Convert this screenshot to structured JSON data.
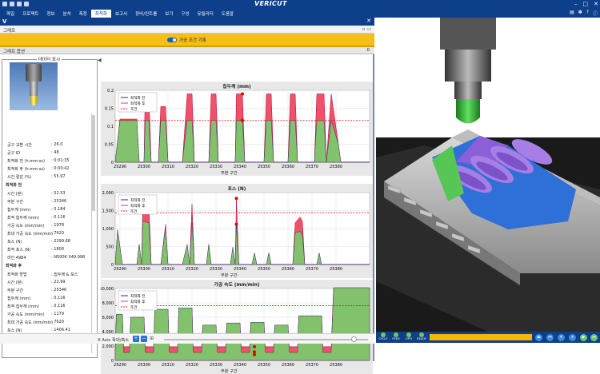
{
  "app": {
    "title": "VERICUT"
  },
  "menu": [
    "파일",
    "프로젝트",
    "정보",
    "분석",
    "측정",
    "최적화",
    "보고서",
    "장비/컨트롤",
    "보기",
    "구성",
    "유틸리티",
    "도움말"
  ],
  "menu_active": 5,
  "pane": {
    "title": "V",
    "tab": "그래프",
    "toggle_label": "가공 조건 기록",
    "options_label": "그래프 옵션",
    "options_count": "0"
  },
  "data_panel": {
    "title": "데이터 표시",
    "rows": [
      {
        "k": "공구 교환 시간",
        "v": ": 26.0",
        "sec": false
      },
      {
        "k": "공구 ID",
        "v": ": 48",
        "sec": false
      },
      {
        "k": "최적화 전 (h:mm:ss)",
        "v": ": 0:01:35",
        "sec": false
      },
      {
        "k": "최적화 후 (h:mm:ss)",
        "v": ": 0:00:42",
        "sec": false
      },
      {
        "k": "시간 절감 (%)",
        "v": ": 55.97",
        "sec": false
      },
      {
        "k": "최적화 전",
        "v": "",
        "sec": true
      },
      {
        "k": "시간 (분)",
        "v": ": 52.53",
        "sec": false
      },
      {
        "k": "부분 구간",
        "v": ": 25346",
        "sec": false
      },
      {
        "k": "칩두께 (mm)",
        "v": ": 0.184",
        "sec": false
      },
      {
        "k": "최적 칩두께 (mm)",
        "v": ": 0.116",
        "sec": false
      },
      {
        "k": "가공 속도 (mm/min)",
        "v": ": 1978",
        "sec": false
      },
      {
        "k": "최대 가공 속도 (mm/min)",
        "v": ": 7620",
        "sec": false
      },
      {
        "k": "포스 (N)",
        "v": ": 2299.68",
        "sec": false
      },
      {
        "k": "최적 포스 (N)",
        "v": ": 1800",
        "sec": false
      },
      {
        "k": "라인 4984",
        "v": ": N5006 X49.996",
        "sec": false
      },
      {
        "k": "최적화 후",
        "v": "",
        "sec": true
      },
      {
        "k": "최적화 방법",
        "v": ": 칩두께 & 포스",
        "sec": false
      },
      {
        "k": "시간 (분)",
        "v": ": 22.99",
        "sec": false
      },
      {
        "k": "부분 구간",
        "v": ": 25346",
        "sec": false
      },
      {
        "k": "칩두께 (mm)",
        "v": ": 0.116",
        "sec": false
      },
      {
        "k": "최적 칩두께 (mm)",
        "v": ": 0.116",
        "sec": false
      },
      {
        "k": "가공 속도 (mm/min)",
        "v": ": 1179",
        "sec": false
      },
      {
        "k": "최대 가공 속도 (mm/min)",
        "v": ": 7620",
        "sec": false
      },
      {
        "k": "포스 (N)",
        "v": ": 1406.41",
        "sec": false
      },
      {
        "k": "최적 포스 (N)",
        "v": ": 1800",
        "sec": false
      }
    ]
  },
  "bottom": {
    "x_axis_label": "X Axis 확대/축소"
  },
  "viewer": {
    "controls": [
      "CYCLE",
      "FEED",
      "OPTI",
      "READY"
    ]
  },
  "chart_data": [
    {
      "type": "area",
      "title": "칩두께 (mm)",
      "xlabel": "부분 구간",
      "ylim": [
        0,
        0.2
      ],
      "yticks": [
        "0",
        "0.05",
        "0.1",
        "0.15",
        "0.2"
      ],
      "xticks": [
        "25290",
        "25300",
        "25310",
        "25320",
        "25330",
        "25340",
        "25350",
        "25360",
        "25370",
        "25380"
      ],
      "xlim": [
        25288,
        25394
      ],
      "limit": 0.116,
      "legend": [
        "최적화 전",
        "최적화 후",
        "조건"
      ],
      "before": [
        [
          25288,
          0
        ],
        [
          25290,
          0.12
        ],
        [
          25297,
          0.12
        ],
        [
          25298,
          0
        ],
        [
          25300,
          0
        ],
        [
          25300.5,
          0.19
        ],
        [
          25302,
          0.19
        ],
        [
          25303,
          0
        ],
        [
          25306,
          0
        ],
        [
          25307,
          0.155
        ],
        [
          25309,
          0.155
        ],
        [
          25310,
          0
        ],
        [
          25316,
          0
        ],
        [
          25318,
          0.19
        ],
        [
          25320,
          0.19
        ],
        [
          25321,
          0
        ],
        [
          25327,
          0
        ],
        [
          25328,
          0.19
        ],
        [
          25330,
          0.19
        ],
        [
          25331,
          0
        ],
        [
          25338,
          0
        ],
        [
          25338.5,
          0.19
        ],
        [
          25341,
          0.19
        ],
        [
          25342,
          0
        ],
        [
          25350,
          0
        ],
        [
          25351,
          0.19
        ],
        [
          25353,
          0.19
        ],
        [
          25354,
          0
        ],
        [
          25360,
          0
        ],
        [
          25361,
          0.19
        ],
        [
          25363,
          0.19
        ],
        [
          25364,
          0
        ],
        [
          25371,
          0
        ],
        [
          25372,
          0.19
        ],
        [
          25375,
          0.19
        ],
        [
          25376,
          0
        ],
        [
          25378,
          0.19
        ],
        [
          25381,
          0.05
        ],
        [
          25382,
          0
        ],
        [
          25394,
          0
        ]
      ],
      "after": [
        [
          25288,
          0
        ],
        [
          25290,
          0.116
        ],
        [
          25297,
          0.116
        ],
        [
          25298,
          0
        ],
        [
          25300,
          0
        ],
        [
          25300.5,
          0.116
        ],
        [
          25302,
          0.116
        ],
        [
          25303,
          0
        ],
        [
          25306,
          0
        ],
        [
          25307,
          0.116
        ],
        [
          25309,
          0.116
        ],
        [
          25310,
          0
        ],
        [
          25316,
          0
        ],
        [
          25318,
          0.116
        ],
        [
          25320,
          0.116
        ],
        [
          25321,
          0
        ],
        [
          25327,
          0
        ],
        [
          25328,
          0.116
        ],
        [
          25330,
          0.116
        ],
        [
          25331,
          0
        ],
        [
          25338,
          0
        ],
        [
          25338.5,
          0.116
        ],
        [
          25341,
          0.116
        ],
        [
          25342,
          0
        ],
        [
          25350,
          0
        ],
        [
          25351,
          0.116
        ],
        [
          25353,
          0.116
        ],
        [
          25354,
          0
        ],
        [
          25360,
          0
        ],
        [
          25361,
          0.116
        ],
        [
          25363,
          0.116
        ],
        [
          25364,
          0
        ],
        [
          25371,
          0
        ],
        [
          25372,
          0.116
        ],
        [
          25375,
          0.116
        ],
        [
          25376,
          0
        ],
        [
          25378,
          0.116
        ],
        [
          25381,
          0.05
        ],
        [
          25382,
          0
        ],
        [
          25394,
          0
        ]
      ],
      "markers": [
        [
          25341,
          0.19
        ],
        [
          25341,
          0.116
        ]
      ]
    },
    {
      "type": "area",
      "title": "포스 (N)",
      "xlabel": "부분 구간",
      "ylim": [
        0,
        2500
      ],
      "yticks": [
        "0",
        "500",
        "1,000",
        "1,500",
        "2,000"
      ],
      "xticks": [
        "25290",
        "25300",
        "25310",
        "25320",
        "25330",
        "25340",
        "25350",
        "25360",
        "25370",
        "25380"
      ],
      "xlim": [
        25288,
        25394
      ],
      "limit": 1800,
      "legend": [
        "최적화 전",
        "최적화 후",
        "조건"
      ],
      "before": [
        [
          25288,
          0
        ],
        [
          25289,
          1200
        ],
        [
          25291,
          0
        ],
        [
          25297,
          0
        ],
        [
          25298,
          700
        ],
        [
          25299,
          0
        ],
        [
          25299.5,
          2150
        ],
        [
          25302,
          2150
        ],
        [
          25303,
          0
        ],
        [
          25307,
          0
        ],
        [
          25309,
          1400
        ],
        [
          25310,
          0
        ],
        [
          25316,
          0
        ],
        [
          25318,
          700
        ],
        [
          25319,
          0
        ],
        [
          25320,
          2100
        ],
        [
          25321,
          0
        ],
        [
          25326,
          0
        ],
        [
          25327,
          700
        ],
        [
          25328,
          0
        ],
        [
          25336,
          0
        ],
        [
          25337,
          600
        ],
        [
          25338,
          0
        ],
        [
          25338.5,
          2300
        ],
        [
          25339.5,
          0
        ],
        [
          25345,
          0
        ],
        [
          25346,
          400
        ],
        [
          25347,
          0
        ],
        [
          25351,
          0
        ],
        [
          25352,
          400
        ],
        [
          25353,
          0
        ],
        [
          25362,
          0
        ],
        [
          25363,
          1450
        ],
        [
          25365,
          1650
        ],
        [
          25366,
          1500
        ],
        [
          25367,
          0
        ],
        [
          25372,
          0
        ],
        [
          25373,
          400
        ],
        [
          25374,
          0
        ],
        [
          25380,
          0
        ],
        [
          25394,
          0
        ]
      ],
      "after": [
        [
          25288,
          0
        ],
        [
          25289,
          1200
        ],
        [
          25291,
          0
        ],
        [
          25297,
          0
        ],
        [
          25298,
          700
        ],
        [
          25299,
          0
        ],
        [
          25299.5,
          1500
        ],
        [
          25302,
          1450
        ],
        [
          25303,
          0
        ],
        [
          25307,
          0
        ],
        [
          25309,
          1300
        ],
        [
          25310,
          0
        ],
        [
          25316,
          0
        ],
        [
          25318,
          700
        ],
        [
          25319,
          0
        ],
        [
          25320,
          1450
        ],
        [
          25321,
          0
        ],
        [
          25326,
          0
        ],
        [
          25327,
          700
        ],
        [
          25328,
          0
        ],
        [
          25336,
          0
        ],
        [
          25337,
          600
        ],
        [
          25338,
          0
        ],
        [
          25338.5,
          1400
        ],
        [
          25339.5,
          0
        ],
        [
          25345,
          0
        ],
        [
          25346,
          400
        ],
        [
          25347,
          0
        ],
        [
          25351,
          0
        ],
        [
          25352,
          400
        ],
        [
          25353,
          0
        ],
        [
          25362,
          0
        ],
        [
          25363,
          1100
        ],
        [
          25365,
          1150
        ],
        [
          25366,
          1000
        ],
        [
          25367,
          0
        ],
        [
          25372,
          0
        ],
        [
          25373,
          400
        ],
        [
          25374,
          0
        ],
        [
          25380,
          0
        ],
        [
          25394,
          0
        ]
      ],
      "markers": [
        [
          25338.5,
          2300
        ],
        [
          25338.5,
          1400
        ]
      ]
    },
    {
      "type": "area",
      "title": "가공 속도 (mm/min)",
      "xlabel": "부분 구간",
      "ylim": [
        0,
        10000
      ],
      "yticks": [
        "0",
        "2,000",
        "4,000",
        "6,000",
        "8,000",
        "10,000"
      ],
      "xticks": [
        "25290",
        "25300",
        "25310",
        "25320",
        "25330",
        "25340",
        "25350",
        "25360",
        "25370",
        "25380"
      ],
      "xlim": [
        25288,
        25394
      ],
      "limit": 7620,
      "legend": [
        "최적화 전",
        "최적화 후",
        "조건"
      ],
      "before": [
        [
          25288,
          1900
        ],
        [
          25288.5,
          6400
        ],
        [
          25291,
          6400
        ],
        [
          25291.5,
          1900
        ],
        [
          25294,
          1900
        ],
        [
          25294.5,
          6000
        ],
        [
          25300,
          6000
        ],
        [
          25300.5,
          1900
        ],
        [
          25304,
          1900
        ],
        [
          25304.5,
          7100
        ],
        [
          25310,
          7100
        ],
        [
          25310.5,
          1900
        ],
        [
          25314,
          1900
        ],
        [
          25314.5,
          7300
        ],
        [
          25320,
          7300
        ],
        [
          25320.5,
          1900
        ],
        [
          25324,
          1900
        ],
        [
          25324.5,
          4900
        ],
        [
          25330,
          4900
        ],
        [
          25330.5,
          1900
        ],
        [
          25334,
          1900
        ],
        [
          25334.5,
          5200
        ],
        [
          25340,
          5200
        ],
        [
          25340.5,
          1900
        ],
        [
          25344,
          1900
        ],
        [
          25344.5,
          5300
        ],
        [
          25350,
          5300
        ],
        [
          25350.5,
          1900
        ],
        [
          25354,
          1900
        ],
        [
          25354.5,
          4900
        ],
        [
          25360,
          4900
        ],
        [
          25360.5,
          1900
        ],
        [
          25364,
          1900
        ],
        [
          25364.5,
          6200
        ],
        [
          25374,
          6200
        ],
        [
          25374.5,
          1900
        ],
        [
          25378,
          1900
        ],
        [
          25379,
          10100
        ],
        [
          25394,
          10100
        ]
      ],
      "after": [
        [
          25288,
          1100
        ],
        [
          25288.5,
          6400
        ],
        [
          25291,
          6400
        ],
        [
          25291.5,
          1100
        ],
        [
          25294,
          1100
        ],
        [
          25294.5,
          6000
        ],
        [
          25300,
          6000
        ],
        [
          25300.5,
          1100
        ],
        [
          25304,
          1100
        ],
        [
          25304.5,
          7100
        ],
        [
          25310,
          7100
        ],
        [
          25310.5,
          1100
        ],
        [
          25314,
          1100
        ],
        [
          25314.5,
          7300
        ],
        [
          25320,
          7300
        ],
        [
          25320.5,
          1100
        ],
        [
          25324,
          1100
        ],
        [
          25324.5,
          4900
        ],
        [
          25330,
          4900
        ],
        [
          25330.5,
          1100
        ],
        [
          25334,
          1100
        ],
        [
          25334.5,
          5200
        ],
        [
          25340,
          5200
        ],
        [
          25340.5,
          1100
        ],
        [
          25344,
          1100
        ],
        [
          25344.5,
          5300
        ],
        [
          25350,
          5300
        ],
        [
          25350.5,
          1100
        ],
        [
          25354,
          1100
        ],
        [
          25354.5,
          4900
        ],
        [
          25360,
          4900
        ],
        [
          25360.5,
          1100
        ],
        [
          25364,
          1100
        ],
        [
          25364.5,
          6200
        ],
        [
          25374,
          6200
        ],
        [
          25374.5,
          1100
        ],
        [
          25378,
          1100
        ],
        [
          25379,
          10100
        ],
        [
          25394,
          10100
        ]
      ],
      "markers": [
        [
          25346,
          1900
        ],
        [
          25346,
          1179
        ],
        [
          25346,
          800
        ]
      ]
    }
  ]
}
